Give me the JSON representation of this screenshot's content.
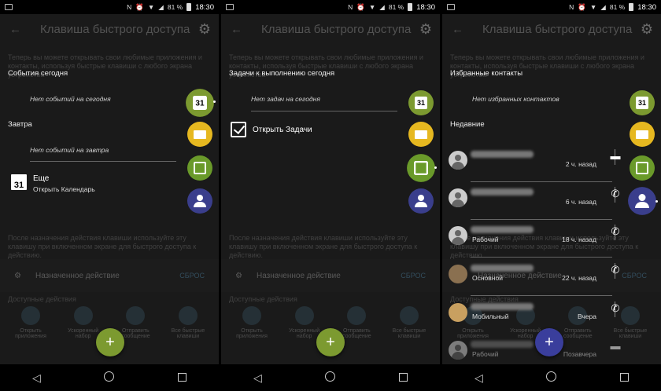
{
  "status": {
    "battery": "81 %",
    "time": "18:30"
  },
  "appbar": {
    "title": "Клавиша быстрого доступа"
  },
  "bg": {
    "intro": "Теперь вы можете открывать свои любимые приложения и контакты, используя быстрые клавиши с любого экрана устройства",
    "footnote": "После назначения действия клавиши используйте эту клавишу при включенном экране для быстрого доступа к действию.",
    "assigned": "Назначенное действие",
    "reset": "СБРОС",
    "available": "Доступные действия",
    "shortcuts": [
      "Открыть приложения",
      "Ускоренный набор",
      "Отправить сообщение",
      "Все быстрые клавиши"
    ]
  },
  "screen1": {
    "today_label": "События сегодня",
    "today_empty": "Нет событий на сегодня",
    "tomorrow_label": "Завтра",
    "tomorrow_empty": "Нет событий на завтра",
    "more_title": "Еще",
    "more_sub": "Открыть Календарь",
    "cal_day": "31"
  },
  "screen2": {
    "tasks_label": "Задачи к выполнению сегодня",
    "tasks_empty": "Нет задач на сегодня",
    "open_tasks": "Открыть Задачи",
    "cal_day": "31"
  },
  "screen3": {
    "fav_label": "Избранные контакты",
    "fav_empty": "Нет избранных контактов",
    "recent_label": "Недавние",
    "cal_day": "31",
    "contacts": [
      {
        "kind": "",
        "ago": "2 ч. назад",
        "action": "message-icon"
      },
      {
        "kind": "",
        "ago": "6 ч. назад",
        "action": "phone-icon"
      },
      {
        "kind": "Рабочий",
        "ago": "18 ч. назад",
        "action": "phone-icon"
      },
      {
        "kind": "Основной",
        "ago": "22 ч. назад",
        "action": "phone-icon"
      },
      {
        "kind": "Мобильный",
        "ago": "Вчера",
        "action": "phone-icon"
      },
      {
        "kind": "Рабочий",
        "ago": "Позавчера",
        "action": "message-icon"
      }
    ]
  },
  "fab": {
    "label": "+"
  },
  "colors": {
    "calendar": "#7c9a30",
    "mail": "#e6b820",
    "tasks": "#6a9a2a",
    "contacts": "#3a3e8c",
    "fab_blue": "#3a3e9c"
  }
}
